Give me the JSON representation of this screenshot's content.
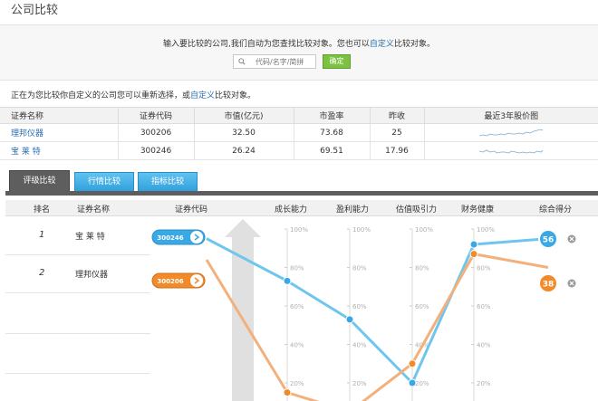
{
  "page": {
    "title": "公司比较"
  },
  "search": {
    "hint_before": "输入要比较的公司,我们自动为您查找比较对象。您也可以",
    "hint_link": "自定义",
    "hint_after": "比较对象。",
    "placeholder": "代码/名字/简拼",
    "confirm_label": "确定"
  },
  "notice": {
    "before": "正在为您比较你自定义的公司您可以重新选择，或",
    "link": "自定义",
    "after": "比较对象。"
  },
  "stock_table": {
    "headers": [
      "证券名称",
      "证券代码",
      "市值(亿元)",
      "市盈率",
      "昨收",
      "最近3年股价图"
    ],
    "rows": [
      {
        "name": "理邦仪器",
        "code": "300206",
        "market_cap": "32.50",
        "pe": "73.68",
        "prev_close": "25"
      },
      {
        "name": "宝 莱 特",
        "code": "300246",
        "market_cap": "26.24",
        "pe": "69.51",
        "prev_close": "17.96"
      }
    ]
  },
  "tabs": [
    {
      "label": "评级比较",
      "active": true
    },
    {
      "label": "行情比较",
      "active": false
    },
    {
      "label": "指标比较",
      "active": false
    }
  ],
  "compare_table": {
    "headers": {
      "rank": "排名",
      "name": "证券名称",
      "code": "证券代码",
      "growth": "成长能力",
      "profit": "盈利能力",
      "valuation": "估值吸引力",
      "health": "财务健康",
      "score": "综合得分"
    },
    "rows": [
      {
        "rank": "1",
        "name": "宝 莱 特"
      },
      {
        "rank": "2",
        "name": "理邦仪器"
      }
    ]
  },
  "chart_data": {
    "type": "line",
    "axis_tick_labels": [
      "100%",
      "80%",
      "60%",
      "40%",
      "20%"
    ],
    "categories": [
      "成长能力",
      "盈利能力",
      "估值吸引力",
      "财务健康"
    ],
    "series": [
      {
        "name": "300246",
        "color": "#6ec6ef",
        "values": [
          73,
          53,
          20,
          92
        ],
        "start": 95,
        "score": "56"
      },
      {
        "name": "300206",
        "color": "#f4b07a",
        "values": [
          15,
          5,
          30,
          87
        ],
        "start": 84,
        "score": "38"
      }
    ]
  },
  "colors": {
    "accent_blue": "#2a6fb0",
    "confirm_green": "#7cc142",
    "tab_active": "#5e5e5e",
    "blue_badge": "#3aa8e4",
    "orange_badge": "#f08a2b"
  }
}
